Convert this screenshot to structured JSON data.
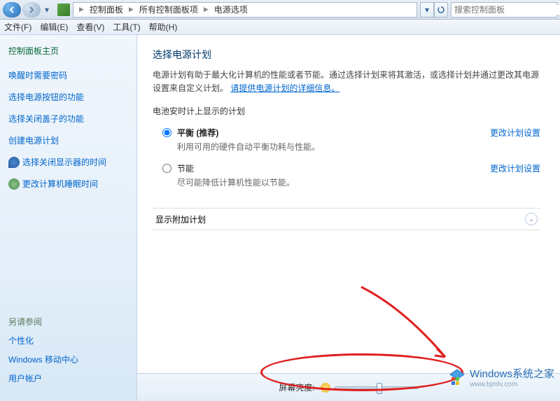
{
  "titlebar": {
    "breadcrumb": [
      "控制面板",
      "所有控制面板项",
      "电源选项"
    ],
    "search_placeholder": "搜索控制面板"
  },
  "menubar": {
    "file": "文件(F)",
    "edit": "编辑(E)",
    "view": "查看(V)",
    "tools": "工具(T)",
    "help": "帮助(H)"
  },
  "sidebar": {
    "home": "控制面板主页",
    "links": [
      "唤醒时需要密码",
      "选择电源按钮的功能",
      "选择关闭盖子的功能",
      "创建电源计划"
    ],
    "icon_links": [
      {
        "label": "选择关闭显示器的时间"
      },
      {
        "label": "更改计算机睡眠时间"
      }
    ],
    "seealso_hdr": "另请参阅",
    "seealso": [
      "个性化",
      "Windows 移动中心",
      "用户帐户"
    ]
  },
  "main": {
    "title": "选择电源计划",
    "desc_before": "电源计划有助于最大化计算机的性能或者节能。通过选择计划来将其激活，或选择计划并通过更改其电源设置来自定义计划。",
    "desc_link": "请提供电源计划的详细信息。",
    "section1": "电池安时计上显示的计划",
    "plans": [
      {
        "name": "平衡 (推荐)",
        "desc": "利用可用的硬件自动平衡功耗与性能。",
        "action": "更改计划设置",
        "checked": true
      },
      {
        "name": "节能",
        "desc": "尽可能降低计算机性能以节能。",
        "action": "更改计划设置",
        "checked": false
      }
    ],
    "expander": "显示附加计划"
  },
  "footer": {
    "brightness_label": "屏幕亮度:"
  },
  "watermark": {
    "line1": "Windows系统之家",
    "line2": "www.bjmlv.com"
  }
}
